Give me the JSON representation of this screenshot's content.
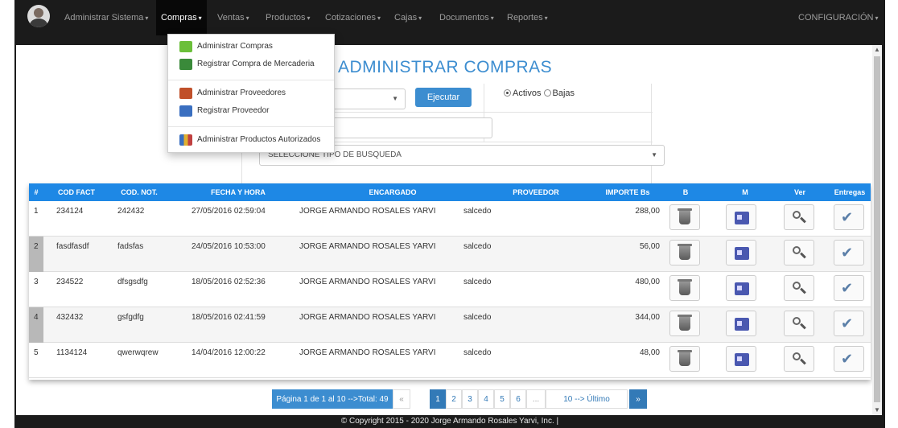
{
  "navbar": {
    "items": [
      {
        "label": "Administrar Sistema"
      },
      {
        "label": "Compras"
      },
      {
        "label": "Ventas"
      },
      {
        "label": "Productos"
      },
      {
        "label": "Cotizaciones"
      },
      {
        "label": "Cajas"
      },
      {
        "label": "Documentos"
      },
      {
        "label": "Reportes"
      }
    ],
    "settings_label": "CONFIGURACIÓN",
    "caret": "▾"
  },
  "dropdown": {
    "items": [
      {
        "label": "Administrar Compras"
      },
      {
        "label": "Registrar Compra de Mercaderia"
      },
      {
        "label": "Administrar Proveedores"
      },
      {
        "label": "Registrar Proveedor"
      },
      {
        "label": "Administrar Productos Autorizados"
      }
    ]
  },
  "page_title": "ADMINISTRAR COMPRAS",
  "filters": {
    "execute_label": "Ejecutar",
    "radio_active": "Activos",
    "radio_inactive": "Bajas",
    "search_type_placeholder": "SELECCIONE TIPO DE BUSQUEDA"
  },
  "table": {
    "headers": [
      "#",
      "COD FACT",
      "COD. NOT.",
      "FECHA Y HORA",
      "ENCARGADO",
      "PROVEEDOR",
      "IMPORTE Bs",
      "B",
      "M",
      "Ver",
      "Entregas"
    ],
    "rows": [
      {
        "n": "1",
        "cod_fact": "234124",
        "cod_not": "242432",
        "fecha": "27/05/2016 02:59:04",
        "encargado": "JORGE ARMANDO ROSALES YARVI",
        "proveedor": "salcedo",
        "importe": "288,00"
      },
      {
        "n": "2",
        "cod_fact": "fasdfasdf",
        "cod_not": "fadsfas",
        "fecha": "24/05/2016 10:53:00",
        "encargado": "JORGE ARMANDO ROSALES YARVI",
        "proveedor": "salcedo",
        "importe": "56,00"
      },
      {
        "n": "3",
        "cod_fact": "234522",
        "cod_not": "dfsgsdfg",
        "fecha": "18/05/2016 02:52:36",
        "encargado": "JORGE ARMANDO ROSALES YARVI",
        "proveedor": "salcedo",
        "importe": "480,00"
      },
      {
        "n": "4",
        "cod_fact": "432432",
        "cod_not": "gsfgdfg",
        "fecha": "18/05/2016 02:41:59",
        "encargado": "JORGE ARMANDO ROSALES YARVI",
        "proveedor": "salcedo",
        "importe": "344,00"
      },
      {
        "n": "5",
        "cod_fact": "1134124",
        "cod_not": "qwerwqrew",
        "fecha": "14/04/2016 12:00:22",
        "encargado": "JORGE ARMANDO ROSALES YARVI",
        "proveedor": "salcedo",
        "importe": "48,00"
      }
    ]
  },
  "pagination": {
    "info": "Página 1 de 1 al 10 -->Total: 49",
    "prev": "«",
    "pages": [
      "1",
      "2",
      "3",
      "4",
      "5",
      "6"
    ],
    "ellipsis": "...",
    "last": "10 --> Último",
    "next": "»",
    "current_page": 1
  },
  "footer": "© Copyright 2015 - 2020 Jorge Armando Rosales Yarvi, Inc. |",
  "colors": {
    "navbar_bg": "#1b1b1b",
    "accent": "#3c8dd0",
    "table_header": "#1e88e5"
  }
}
